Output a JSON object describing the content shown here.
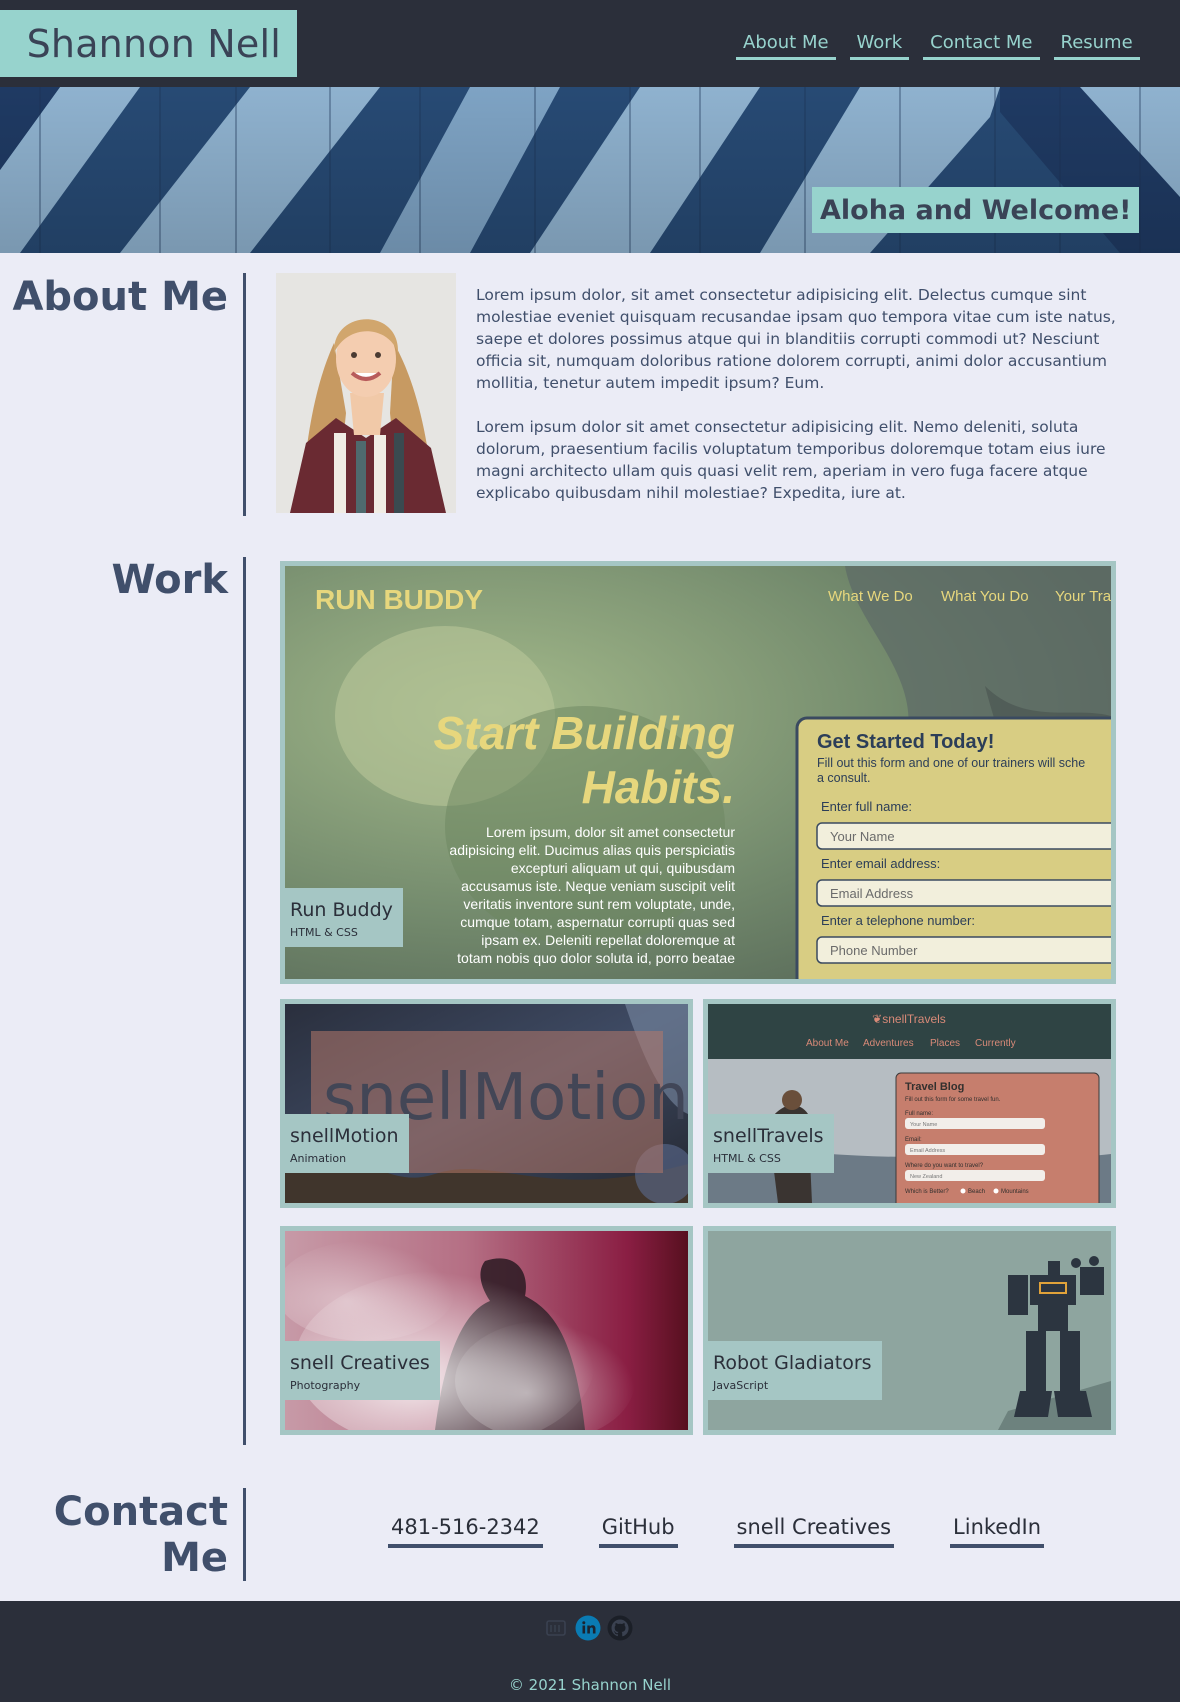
{
  "header": {
    "brand_name": "Shannon Nell",
    "nav": [
      "About Me",
      "Work",
      "Contact Me",
      "Resume"
    ]
  },
  "hero": {
    "greeting": "Aloha and Welcome!"
  },
  "about": {
    "title": "About Me",
    "paragraphs": [
      "Lorem ipsum dolor, sit amet consectetur adipisicing elit. Delectus cumque sint molestiae eveniet quisquam recusandae ipsam quo tempora vitae cum iste natus, saepe et dolores possimus atque qui in blanditiis corrupti commodi ut? Nesciunt officia sit, numquam doloribus ratione dolorem corrupti, animi dolor accusantium mollitia, tenetur autem impedit ipsum? Eum.",
      "Lorem ipsum dolor sit amet consectetur adipisicing elit. Nemo deleniti, soluta dolorum, praesentium facilis voluptatum temporibus doloremque totam eius iure magni architecto ullam quis quasi velit rem, aperiam in vero fuga facere atque explicabo quibusdam nihil molestiae? Expedita, iure at."
    ]
  },
  "work": {
    "title": "Work",
    "projects": [
      {
        "name": "Run Buddy",
        "tech": "HTML & CSS",
        "screenshot": {
          "logo": "RUN BUDDY",
          "nav": [
            "What We Do",
            "What You Do",
            "Your Tra"
          ],
          "headline_1": "Start Building",
          "headline_2": "Habits.",
          "body_lines": [
            "Lorem ipsum, dolor sit amet consectetur",
            "adipisicing elit. Ducimus alias quis perspiciatis",
            "excepturi aliquam ut qui, quibusdam",
            "accusamus iste. Neque veniam suscipit velit",
            "veritatis inventore sunt rem voluptate, unde,",
            "cumque totam, aspernatur corrupti quas sed",
            "ipsam ex. Deleniti repellat doloremque at",
            "totam nobis quo dolor soluta id, porro beatae"
          ],
          "form_title": "Get Started Today!",
          "form_sub_1": "Fill out this form and one of our trainers will sche",
          "form_sub_2": "a consult.",
          "field_labels": [
            "Enter full name:",
            "Enter email address:",
            "Enter a telephone number:"
          ],
          "field_placeholders": [
            "Your Name",
            "Email Address",
            "Phone Number"
          ]
        }
      },
      {
        "name": "snellMotion",
        "tech": "Animation",
        "screenshot": {
          "logo_text": "snellMotion"
        }
      },
      {
        "name": "snellTravels",
        "tech": "HTML & CSS",
        "screenshot": {
          "brand": "❦snellTravels",
          "nav": [
            "About Me",
            "Adventures",
            "Places",
            "Currently"
          ],
          "form_title": "Travel Blog",
          "form_sub": "Fill out this form for some travel fun.",
          "labels": [
            "Full name:",
            "Email:",
            "Where do you want to travel?",
            "Which is Better?"
          ],
          "placeholders": [
            "Your Name",
            "Email Address",
            "New Zealand"
          ],
          "radios": [
            "Beach",
            "Mountains"
          ]
        }
      },
      {
        "name": "snell Creatives",
        "tech": "Photography"
      },
      {
        "name": "Robot Gladiators",
        "tech": "JavaScript"
      }
    ]
  },
  "contact": {
    "title_line1": "Contact",
    "title_line2": "Me",
    "links": [
      "481-516-2342",
      "GitHub",
      "snell Creatives",
      "LinkedIn"
    ]
  },
  "footer": {
    "icons": [
      "snell-creatives-icon",
      "linkedin-icon",
      "github-icon"
    ],
    "copyright": "© 2021 Shannon Nell"
  },
  "colors": {
    "header_bg": "#2b2f3a",
    "accent_teal": "#97d3cd",
    "page_bg": "#ebecf6",
    "heading_navy": "#404f6b",
    "card_frame": "#a5c6c4",
    "linkedin_blue": "#0a7bb3"
  }
}
